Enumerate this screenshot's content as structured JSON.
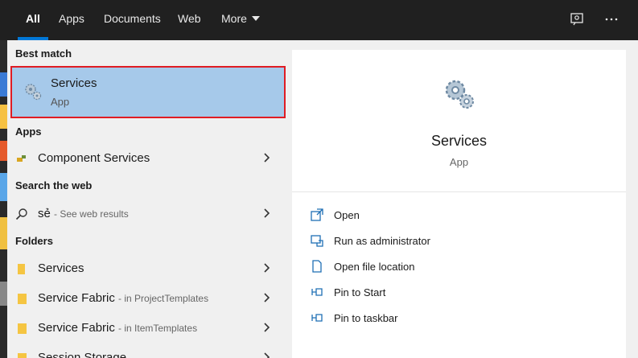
{
  "tabs": [
    {
      "label": "All",
      "active": true
    },
    {
      "label": "Apps"
    },
    {
      "label": "Documents"
    },
    {
      "label": "Web"
    },
    {
      "label": "More"
    }
  ],
  "top_icons": [
    "feedback-icon",
    "more-options-icon"
  ],
  "sections": {
    "best_match": "Best match",
    "apps": "Apps",
    "search_web": "Search the web",
    "folders": "Folders"
  },
  "best_match": {
    "title": "Services",
    "type": "App",
    "icon": "gears-icon"
  },
  "apps": [
    {
      "label": "Component Services",
      "icon": "component-services-icon"
    }
  ],
  "web": {
    "query": "sẻ",
    "suffix": "- See web results",
    "icon": "search-icon"
  },
  "folders": [
    {
      "label": "Services",
      "location": ""
    },
    {
      "label": "Service Fabric",
      "location": "- in ProjectTemplates"
    },
    {
      "label": "Service Fabric",
      "location": "- in ItemTemplates"
    },
    {
      "label": "Session Storage",
      "location": ""
    }
  ],
  "preview": {
    "title": "Services",
    "type": "App"
  },
  "actions": [
    {
      "label": "Open",
      "icon": "open-icon"
    },
    {
      "label": "Run as administrator",
      "icon": "shield-icon"
    },
    {
      "label": "Open file location",
      "icon": "file-location-icon"
    },
    {
      "label": "Pin to Start",
      "icon": "pin-icon"
    },
    {
      "label": "Pin to taskbar",
      "icon": "pin-icon"
    }
  ],
  "colors": {
    "accent": "#0078d7",
    "highlight": "#a6c9ea",
    "annotation_red": "#e01c24",
    "topbar": "#202020",
    "panel": "#f0f0f0"
  }
}
